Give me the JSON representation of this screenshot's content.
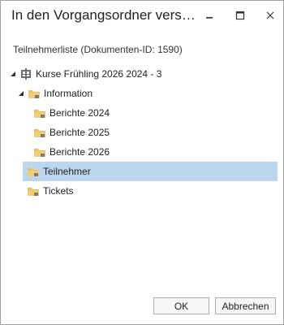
{
  "window": {
    "title": "In den Vorgangsordner versc..."
  },
  "subtitle": "Teilnehmerliste (Dokumenten-ID: 1590)",
  "tree": {
    "root": {
      "label": "Kurse Frühling 2026 2024 - 3",
      "icon": "course-node-icon"
    },
    "information": {
      "label": "Information",
      "icon": "folder-icon"
    },
    "berichte_2024": {
      "label": "Berichte 2024",
      "icon": "folder-icon"
    },
    "berichte_2025": {
      "label": "Berichte 2025",
      "icon": "folder-icon"
    },
    "berichte_2026": {
      "label": "Berichte 2026",
      "icon": "folder-icon"
    },
    "teilnehmer": {
      "label": "Teilnehmer",
      "icon": "folder-icon",
      "selected": true
    },
    "tickets": {
      "label": "Tickets",
      "icon": "folder-icon"
    }
  },
  "buttons": {
    "ok": "OK",
    "cancel": "Abbrechen"
  },
  "colors": {
    "selection": "#bcd6ee",
    "folder": "#e8c063"
  }
}
